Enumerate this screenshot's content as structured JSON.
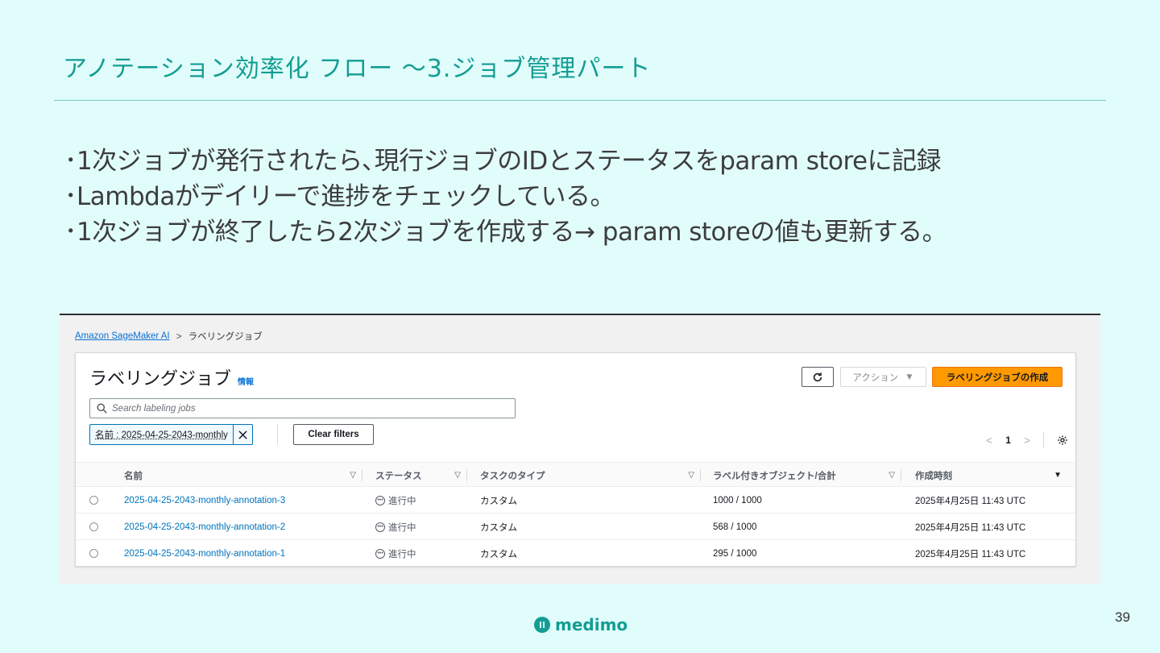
{
  "slide": {
    "title": "アノテーション効率化 フロー ～3.ジョブ管理パート",
    "bullets": [
      "･1次ジョブが発行されたら､現行ジョブのIDとステータスをparam storeに記録",
      "･Lambdaがデイリーで進捗をチェックしている。",
      "･1次ジョブが終了したら2次ジョブを作成する→ param storeの値も更新する。"
    ],
    "logo_text": "medimo",
    "page_number": "39"
  },
  "console": {
    "breadcrumb": {
      "root": "Amazon SageMaker AI",
      "current": "ラベリングジョブ"
    },
    "title": "ラベリングジョブ",
    "info_label": "情報",
    "actions_label": "アクション",
    "create_label": "ラベリングジョブの作成",
    "search_placeholder": "Search labeling jobs",
    "filter_token": "名前 : 2025-04-25-2043-monthly",
    "clear_filters_label": "Clear filters",
    "page": "1",
    "columns": [
      "名前",
      "ステータス",
      "タスクのタイプ",
      "ラベル付きオブジェクト/合計",
      "作成時刻"
    ],
    "rows": [
      {
        "name": "2025-04-25-2043-monthly-annotation-3",
        "status": "進行中",
        "task_type": "カスタム",
        "labeled": "1000 / 1000",
        "created": "2025年4月25日 11:43 UTC"
      },
      {
        "name": "2025-04-25-2043-monthly-annotation-2",
        "status": "進行中",
        "task_type": "カスタム",
        "labeled": "568 / 1000",
        "created": "2025年4月25日 11:43 UTC"
      },
      {
        "name": "2025-04-25-2043-monthly-annotation-1",
        "status": "進行中",
        "task_type": "カスタム",
        "labeled": "295 / 1000",
        "created": "2025年4月25日 11:43 UTC"
      }
    ],
    "colors": {
      "primary_button": "#ff9900",
      "link": "#0073bb"
    }
  }
}
